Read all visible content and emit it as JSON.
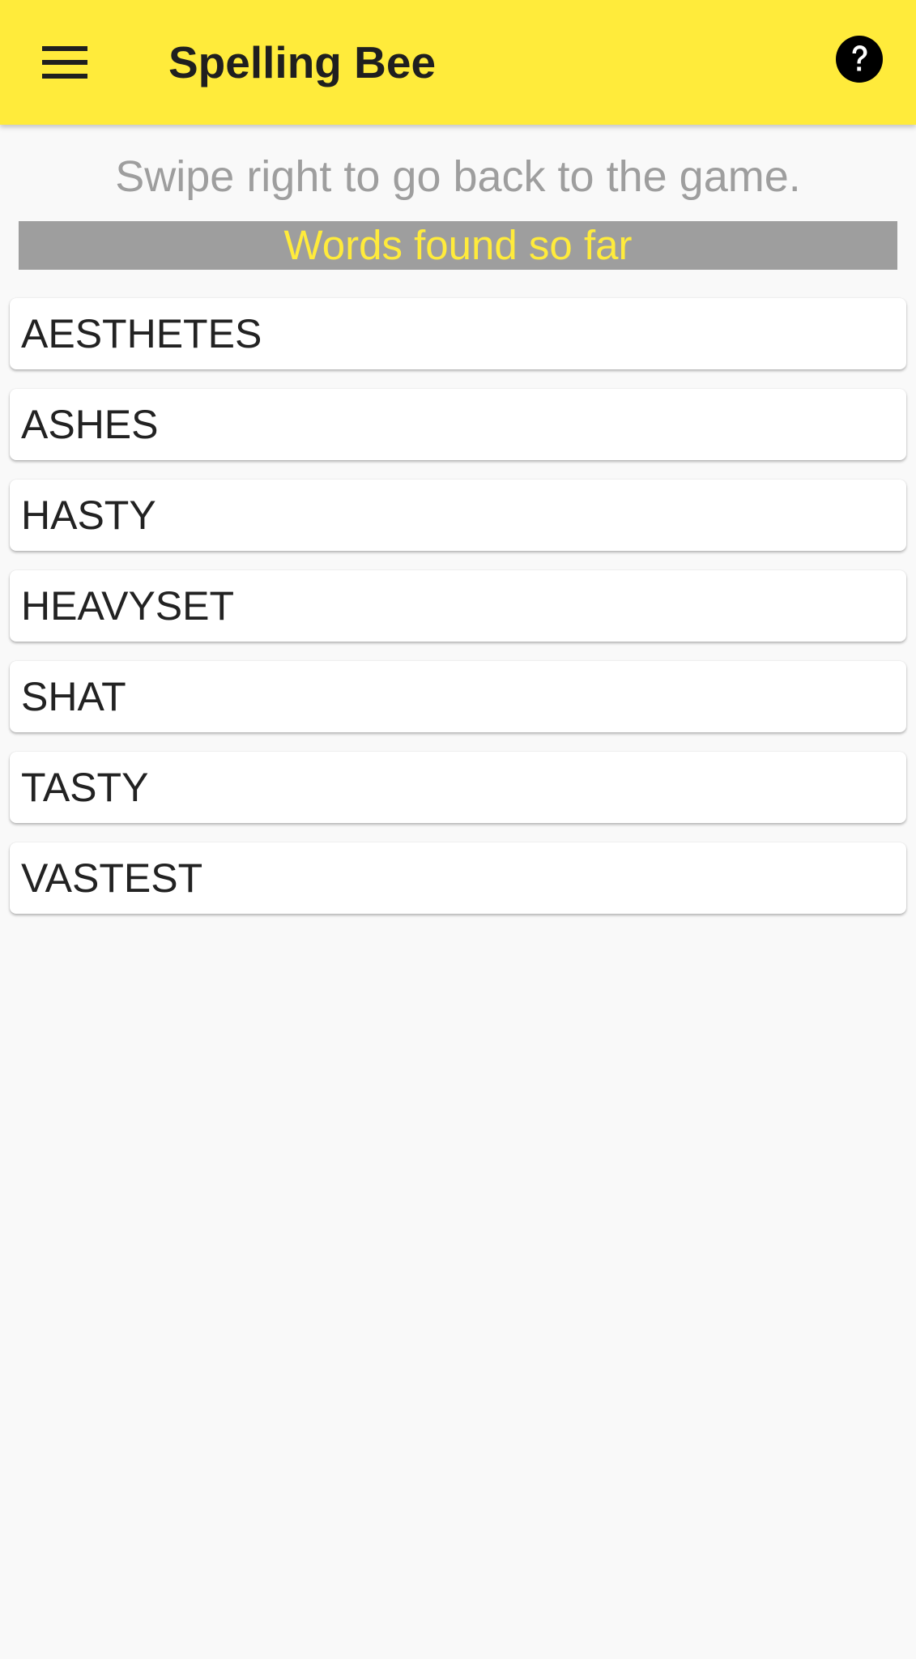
{
  "app_bar": {
    "title": "Spelling Bee",
    "menu_icon": "hamburger-menu-icon",
    "help_icon": "help-circle-icon",
    "background_color": "#ffeb3b"
  },
  "hint": "Swipe right to go back to the game.",
  "section_header": "Words found so far",
  "words": [
    "AESTHETES",
    "ASHES",
    "HASTY",
    "HEAVYSET",
    "SHAT",
    "TASTY",
    "VASTEST"
  ]
}
